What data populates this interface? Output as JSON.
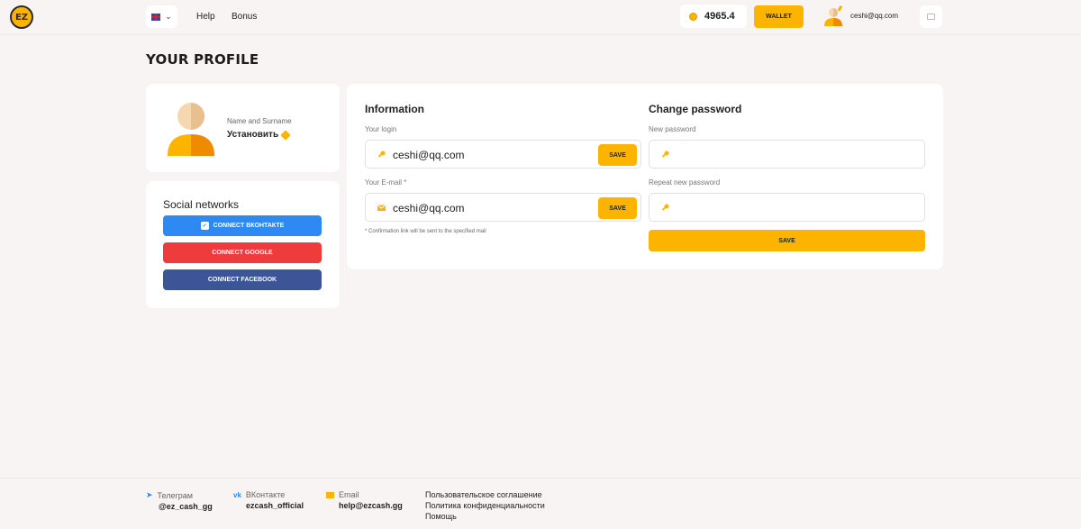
{
  "header": {
    "logo_text": "EZ",
    "nav": {
      "help": "Help",
      "bonus": "Bonus"
    },
    "balance": "4965.4",
    "wallet_label": "WALLET",
    "user_email": "ceshi@qq.com"
  },
  "page_title": "YOUR PROFILE",
  "profile": {
    "name_label": "Name and Surname",
    "name_value": "Установить"
  },
  "social": {
    "title": "Social networks",
    "vk_label": "CONNECT ВКОНТАКТЕ",
    "google_label": "CONNECT GOOGLE",
    "facebook_label": "CONNECT FACEBOOK"
  },
  "information": {
    "title": "Information",
    "login_label": "Your login",
    "login_value": "ceshi@qq.com",
    "email_label": "Your E-mail *",
    "email_value": "ceshi@qq.com",
    "save_label": "SAVE",
    "note": "* Confirmation link will be sent to the specified mail"
  },
  "password": {
    "title": "Change password",
    "new_label": "New password",
    "repeat_label": "Repeat new password",
    "save_label": "SAVE"
  },
  "footer": {
    "telegram": {
      "label": "Телеграм",
      "value": "@ez_cash_gg"
    },
    "vk": {
      "label": "ВКонтакте",
      "value": "ezcash_official"
    },
    "email": {
      "label": "Email",
      "value": "help@ezcash.gg"
    },
    "links": [
      "Пользовательское соглашение",
      "Политика конфиденциальности",
      "Помощь"
    ]
  },
  "colors": {
    "accent": "#fdb400",
    "vk": "#2e89f3",
    "google": "#ee3c3c",
    "facebook": "#3b5596"
  }
}
